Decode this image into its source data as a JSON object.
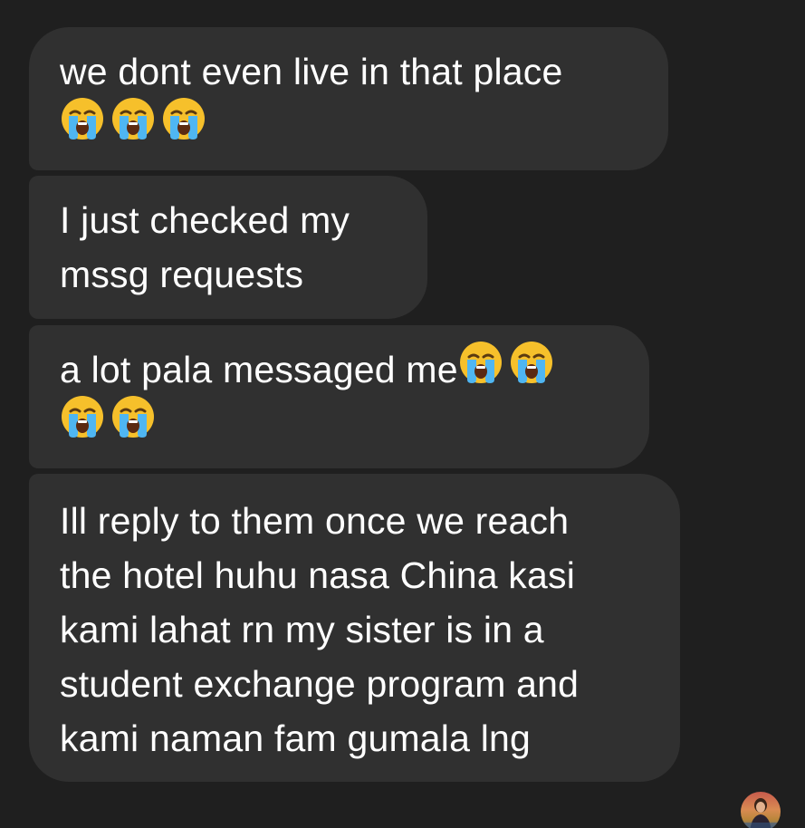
{
  "conversation": {
    "messages": [
      {
        "lines": [
          "we dont even live in that place"
        ],
        "emoji_count": 3,
        "emoji_alt": "😭😭😭"
      },
      {
        "lines": [
          "I just checked my",
          "mssg requests"
        ]
      },
      {
        "lines": [
          "a lot pala messaged me"
        ],
        "inline_emoji_alt": "😭😭",
        "emoji_alt": "😭😭"
      },
      {
        "lines": [
          "Ill reply to them once we reach",
          "the hotel huhu nasa China kasi",
          "kami lahat rn my sister is in a",
          "student exchange program and",
          "kami naman fam gumala lng"
        ]
      }
    ]
  },
  "icons": {
    "emoji": "loudly-crying-face-icon",
    "avatar": "avatar"
  },
  "colors": {
    "background": "#1f1f1f",
    "bubble": "#303030",
    "text": "#ffffff",
    "emoji_face": "#f6c02b",
    "emoji_tears": "#4fb6f2"
  }
}
